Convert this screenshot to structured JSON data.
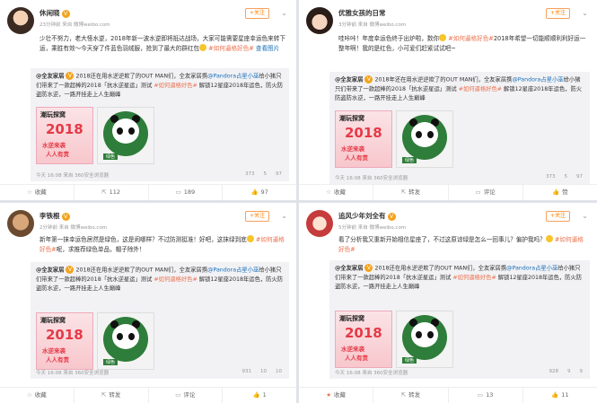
{
  "posts": [
    {
      "user": "休闲晓",
      "meta": "23分钟前 来自 微博weibo.com",
      "follow": "+关注",
      "text": "少壮不努力，老大怪水逆，2018年新一波水逆即将抵达战场，大家可能需要星座幸运色来转下运，乘胜有效～今天穿了件蓝色羽绒服，抢到了最大的群红包",
      "tag": "#如何逼格好色#",
      "link": "查看图片",
      "repost": {
        "name": "@全友家居",
        "text": "2018还在用水逆逆欺了的OUT MAN们，全友家居携",
        "mention": "@Pandora占星小巫",
        "text2": "给小猪只们带来了一款超棒的2018「抗水逆星运」测试",
        "tag": "#如何逼格好色#",
        "text3": "解锁12星座2018年运色，防火防盗防水逆，一路开挂走上人生巅峰"
      },
      "rp_time": "今天 16:08 来自 360安全浏览器",
      "rp_share": "373",
      "rp_comment": "5",
      "rp_like": "97",
      "fav": "收藏",
      "fwd": "112",
      "cmt": "189",
      "like": "97"
    },
    {
      "user": "优雅女孩的日常",
      "meta": "3分钟前 来自 微博weibo.com",
      "follow": "+关注",
      "text": "哇咔咔！年度幸运色终于出炉啦，数你",
      "tag": "#如何逼格好色#",
      "text2": "2018年希望一切能顺顺利利好运一整年啊！我的是红色，小可爱们赶紧试试吧~",
      "repost": {
        "name": "@全友家居",
        "text": "2018年还在用水逆逆欺了的OUT MAN们，全友家居携",
        "mention": "@Pandora占星小巫",
        "text2": "给小猪只们带来了一款超棒的2018「抗水逆星运」测试",
        "tag": "#如何逼格好色#",
        "text3": "解锁12星座2018年运色，防火防盗防水逆，一路开挂走上人生巅峰"
      },
      "rp_time": "今天 16:08 来自 360安全浏览器",
      "rp_share": "373",
      "rp_comment": "5",
      "rp_like": "97",
      "fav": "收藏",
      "fwd": "转发",
      "cmt": "评论",
      "like": "赞"
    },
    {
      "user": "李铁根",
      "meta": "2分钟前 来自 微博weibo.com",
      "follow": "+关注",
      "text": "新年第一抹幸运色居然是绿色，这是闹哪样？不过防测挺准！好吧，这抹绿到底",
      "tag": "#如何逼格好色#",
      "text2": "呢，求推荐绿色单品，帽子除外！",
      "repost": {
        "name": "@全友家居",
        "text": "2018还在用水逆逆欺了的OUT MAN们，全友家居携",
        "mention": "@Pandora占星小巫",
        "text2": "给小猪只们带来了一款超棒的2018「抗水逆星运」测试",
        "tag": "#如何逼格好色#",
        "text3": "解锁12星座2018年运色，防火防盗防水逆，一路开挂走上人生巅峰"
      },
      "rp_time": "今天 16:08 来自 360安全浏览器",
      "rp_share": "931",
      "rp_comment": "10",
      "rp_like": "10",
      "fav": "收藏",
      "fwd": "转发",
      "cmt": "评论",
      "like": "1"
    },
    {
      "user": "追风少年刘全有",
      "meta": "5分钟前 来自 微博weibo.com",
      "follow": "+关注",
      "text": "看了分析我又重新开始相信星座了，不过这原谅绿是怎么一回事儿？偏护我吗？",
      "tag": "#如何逼格好色#",
      "repost": {
        "name": "@全友家居",
        "text": "2018还在用水逆逆欺了的OUT MAN们，全友家居携",
        "mention": "@Pandora占星小巫",
        "text2": "给小猪只们带来了一款超棒的2018「抗水逆星运」测试",
        "tag": "#如何逼格好色#",
        "text3": "解锁12星座2018年运色，防火防盗防水逆，一路开挂走上人生巅峰"
      },
      "rp_time": "今天 16:08 来自 360安全浏览器",
      "rp_share": "928",
      "rp_comment": "9",
      "rp_like": "9",
      "fav": "收藏",
      "fwd": "转发",
      "cmt": "13",
      "like": "11"
    }
  ],
  "thumb": {
    "title": "潮玩探窝",
    "year": "2018",
    "line1": "水逆来袭",
    "line2": "人人有责",
    "panda_label": "绿色"
  },
  "colors": {
    "accent": "#ff8200",
    "tag": "#eb7350",
    "link": "#1a6fb8",
    "badge": "#f3a31c"
  }
}
